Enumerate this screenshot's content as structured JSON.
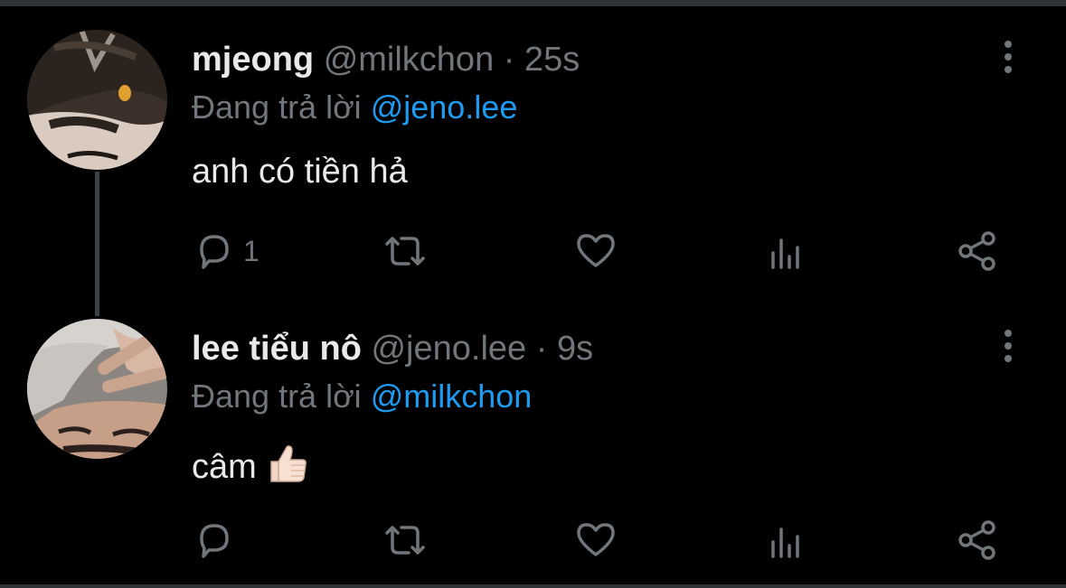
{
  "thread": [
    {
      "display_name": "mjeong",
      "handle": "@milkchon",
      "separator": "·",
      "time": "25s",
      "reply_prefix": "Đang trả lời",
      "reply_to": "@jeno.lee",
      "text": "anh có tiền hả",
      "text_emoji": "",
      "reply_count": "1",
      "avatar": "avatar-dark-hair-with-clip"
    },
    {
      "display_name": "lee tiểu nô",
      "handle": "@jeno.lee",
      "separator": "·",
      "time": "9s",
      "reply_prefix": "Đang trả lời",
      "reply_to": "@milkchon",
      "text": "câm",
      "text_emoji": "thumbs-up-emoji",
      "reply_count": "",
      "avatar": "avatar-silver-hair-peace-sign"
    }
  ],
  "colors": {
    "background": "#000000",
    "primary_text": "#e7e9ea",
    "secondary_text": "#71767b",
    "accent": "#1d9bf0",
    "thread_line": "#3b4045"
  },
  "icons": [
    "reply-icon",
    "retweet-icon",
    "like-icon",
    "views-icon",
    "share-icon",
    "more-options-icon"
  ]
}
